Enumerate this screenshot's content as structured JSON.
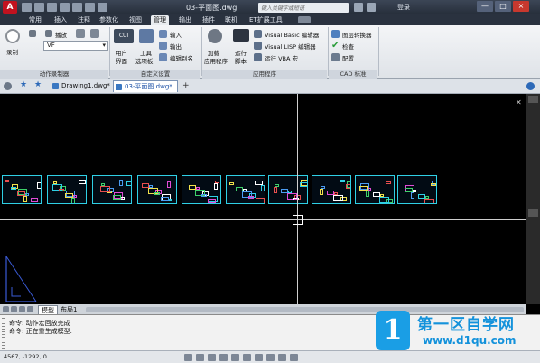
{
  "titlebar": {
    "app_letter": "A",
    "doc_title": "03-平面图.dwg",
    "search_placeholder": "键入关键字或短语",
    "login": "登录",
    "win_controls": [
      "—",
      "□",
      "×"
    ]
  },
  "tabs": [
    "常用",
    "插入",
    "注释",
    "参数化",
    "视图",
    "管理",
    "输出",
    "插件",
    "联机",
    "ET扩展工具"
  ],
  "active_tab": "管理",
  "ribbon": {
    "record_label": "录制",
    "play_label": "播放",
    "vf_value": "VF",
    "panel_action_recorder": "动作录制器",
    "cui_badge": "CUI",
    "user_interface": [
      "用户",
      "界面"
    ],
    "tool_palettes": [
      "工具",
      "选项板"
    ],
    "import": "输入",
    "export": "输出",
    "edit_aliases": "编辑别名",
    "panel_customization": "自定义设置",
    "load_app": [
      "加载",
      "应用程序"
    ],
    "run_script": [
      "运行",
      "脚本"
    ],
    "vb_editor": "Visual Basic 编辑器",
    "lisp_editor": "Visual LISP 编辑器",
    "run_vba": "运行 VBA 宏",
    "panel_applications": "应用程序",
    "layer_translator": "图层转换器",
    "check": "检查",
    "configure": "配置",
    "panel_cad_standards": "CAD 标准"
  },
  "file_tabs": {
    "tabs": [
      {
        "label": "Drawing1.dwg*",
        "active": false
      },
      {
        "label": "03-平面图.dwg*",
        "active": true
      }
    ],
    "add_symbol": "+"
  },
  "layout_tabs": {
    "tabs": [
      {
        "label": "模型",
        "active": true
      },
      {
        "label": "布局1",
        "active": false
      }
    ]
  },
  "command": {
    "lines": [
      "命令: 动作宏回放完成",
      "命令: 正在重生成模型."
    ]
  },
  "status": {
    "coords": "4567, -1292, 0"
  },
  "watermark": {
    "logo": "1",
    "title": "第一区自学网",
    "url": "www.d1qu.com"
  },
  "colors": {
    "accent_blue": "#1492db",
    "sheet_border": "#2fd0e5",
    "drawing_bg": "#000000",
    "app_red": "#c1121f"
  }
}
